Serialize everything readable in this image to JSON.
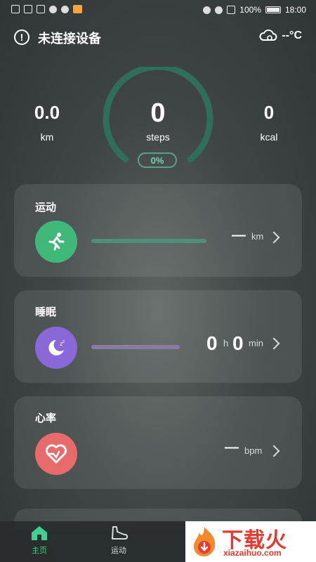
{
  "status": {
    "battery": "100%",
    "time": "18:00"
  },
  "header": {
    "connection_text": "未连接设备",
    "weather_text": "--°C"
  },
  "stats": {
    "distance": {
      "value": "0.0",
      "unit": "km"
    },
    "steps": {
      "value": "0",
      "unit": "steps",
      "percent_text": "0%"
    },
    "calories": {
      "value": "0",
      "unit": "kcal"
    }
  },
  "cards": {
    "sport": {
      "title": "运动",
      "value": "—",
      "unit": "km"
    },
    "sleep": {
      "title": "睡眠",
      "hours": "0",
      "hour_unit": "h",
      "minutes": "0",
      "minute_unit": "min"
    },
    "heart": {
      "title": "心率",
      "value": "—",
      "unit": "bpm"
    }
  },
  "nav": {
    "home": "主页",
    "sport": "运动"
  },
  "watermark": {
    "text_cn": "下载火",
    "text_en": "xiazaihuo.com"
  },
  "colors": {
    "accent_green": "#3fb87a",
    "ring": "#2e6e5a",
    "sleep_purple": "#8a68d8",
    "heart_red": "#e86b6b"
  }
}
